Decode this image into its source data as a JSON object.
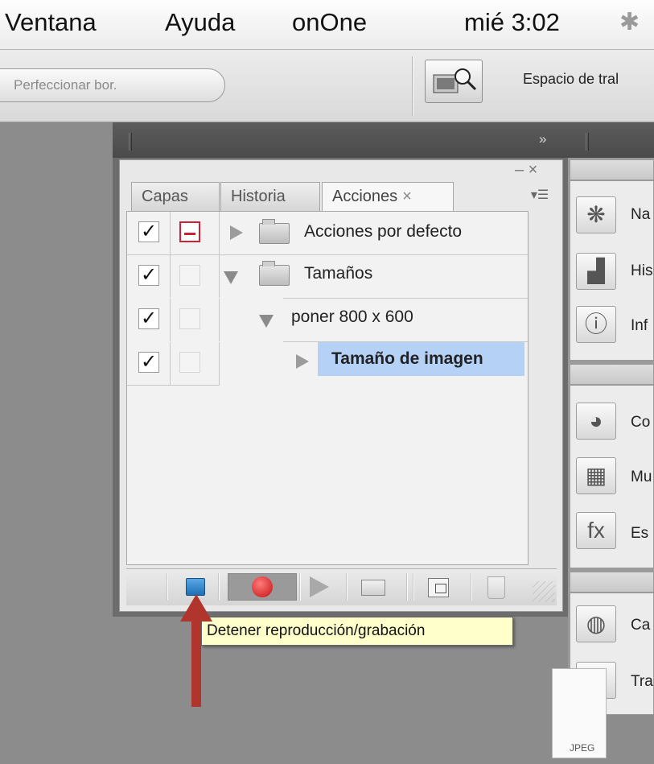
{
  "menubar": {
    "items": [
      "Ventana",
      "Ayuda",
      "onOne"
    ],
    "clock": "mié 3:02"
  },
  "optionsbar": {
    "refine_edge": "Perfeccionar bor.",
    "workspace_label": "Espacio de tral"
  },
  "panel": {
    "tabs": [
      "Capas",
      "Historia",
      "Acciones"
    ],
    "tab_close": "×",
    "close": "– ×",
    "menu": "▾☰"
  },
  "actions": {
    "rows": [
      {
        "label": "Acciones por defecto",
        "checked": "✓"
      },
      {
        "label": "Tamaños",
        "checked": "✓"
      },
      {
        "label": "poner 800 x 600",
        "checked": "✓"
      },
      {
        "label": "Tamaño de imagen",
        "checked": "✓"
      }
    ]
  },
  "tooltip": "Detener reproducción/grabación",
  "right_panels": {
    "labels": [
      "Na",
      "His",
      "Inf",
      "Co",
      "Mu",
      "Es",
      "Ca",
      "Tra"
    ]
  },
  "jpeg_label": "JPEG",
  "colors": {
    "highlight": "#b5d1f6",
    "stop_button": "#2f86cc",
    "record_button": "#d81c1c",
    "arrow": "#b0362d",
    "tooltip_bg": "#ffffcc"
  }
}
